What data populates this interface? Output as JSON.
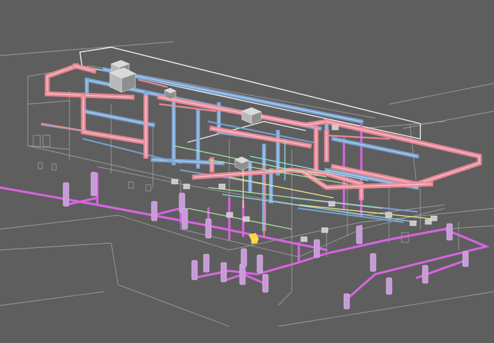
{
  "view": {
    "type": "isometric-3d-mep-model",
    "background": "#5e5e5e"
  },
  "colors": {
    "building_wire": "#a9a9a9",
    "building_wire_light": "#c8c8c8",
    "roof_outline": "#f2f2f2",
    "supply_duct": "#f08c9a",
    "supply_duct_edge": "#ffc6cf",
    "return_duct": "#7aa6d8",
    "return_duct_edge": "#bcd6f3",
    "plumbing_pipe": "#d864e0",
    "plumbing_riser": "#c79ad8",
    "equipment": "#b8b8b8",
    "small_pipe_green": "#a9e7a0",
    "small_pipe_yellow": "#f3ee8a",
    "small_pipe_cyan": "#8fe3e6",
    "highlight_fitting": "#ffd43a"
  },
  "systems": [
    {
      "id": "supply",
      "color_key": "supply_duct"
    },
    {
      "id": "return",
      "color_key": "return_duct"
    },
    {
      "id": "plumbing",
      "color_key": "plumbing_pipe"
    },
    {
      "id": "equipment",
      "color_key": "equipment"
    }
  ]
}
